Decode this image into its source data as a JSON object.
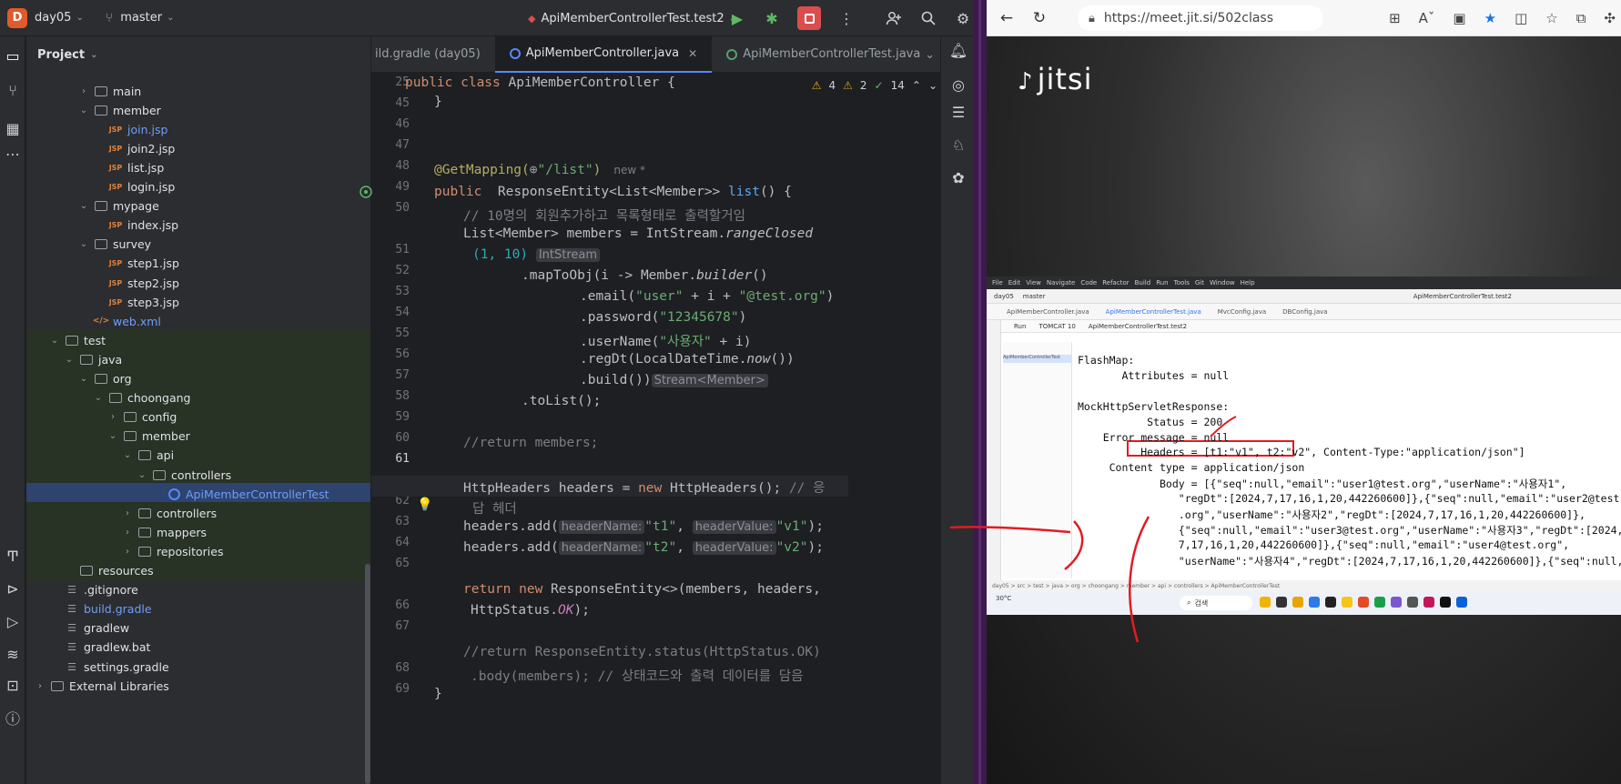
{
  "ide": {
    "project_badge": "D",
    "project_name": "day05",
    "branch": "master",
    "run_config": "ApiMemberControllerTest.test2",
    "project_panel_title": "Project",
    "tabs": [
      {
        "label": "ild.gradle (day05)"
      },
      {
        "label": "ApiMemberController.java"
      },
      {
        "label": "ApiMemberControllerTest.java"
      }
    ],
    "inspections": {
      "warnings": "4",
      "weak": "2",
      "ok": "14"
    },
    "tree": [
      {
        "label": "main",
        "depth": 3,
        "type": "folder",
        "chev": "›"
      },
      {
        "label": "member",
        "depth": 3,
        "type": "folder",
        "chev": "⌄"
      },
      {
        "label": "join.jsp",
        "depth": 4,
        "type": "jsp",
        "cls": "file-blue"
      },
      {
        "label": "join2.jsp",
        "depth": 4,
        "type": "jsp"
      },
      {
        "label": "list.jsp",
        "depth": 4,
        "type": "jsp"
      },
      {
        "label": "login.jsp",
        "depth": 4,
        "type": "jsp"
      },
      {
        "label": "mypage",
        "depth": 3,
        "type": "folder",
        "chev": "⌄"
      },
      {
        "label": "index.jsp",
        "depth": 4,
        "type": "jsp"
      },
      {
        "label": "survey",
        "depth": 3,
        "type": "folder",
        "chev": "⌄"
      },
      {
        "label": "step1.jsp",
        "depth": 4,
        "type": "jsp"
      },
      {
        "label": "step2.jsp",
        "depth": 4,
        "type": "jsp"
      },
      {
        "label": "step3.jsp",
        "depth": 4,
        "type": "jsp"
      },
      {
        "label": "web.xml",
        "depth": 3,
        "type": "xml",
        "cls": "file-blue"
      },
      {
        "label": "test",
        "depth": 1,
        "type": "folder",
        "chev": "⌄",
        "test": true
      },
      {
        "label": "java",
        "depth": 2,
        "type": "folder",
        "chev": "⌄",
        "test": true
      },
      {
        "label": "org",
        "depth": 3,
        "type": "folder",
        "chev": "⌄",
        "test": true
      },
      {
        "label": "choongang",
        "depth": 4,
        "type": "folder",
        "chev": "⌄",
        "test": true
      },
      {
        "label": "config",
        "depth": 5,
        "type": "folder",
        "chev": "›",
        "test": true
      },
      {
        "label": "member",
        "depth": 5,
        "type": "folder",
        "chev": "⌄",
        "test": true
      },
      {
        "label": "api",
        "depth": 6,
        "type": "folder",
        "chev": "⌄",
        "test": true
      },
      {
        "label": "controllers",
        "depth": 7,
        "type": "folder",
        "chev": "⌄",
        "test": true
      },
      {
        "label": "ApiMemberControllerTest",
        "depth": 8,
        "type": "class",
        "test": true,
        "selected": true,
        "cls": "file-blue"
      },
      {
        "label": "controllers",
        "depth": 6,
        "type": "folder",
        "chev": "›",
        "test": true
      },
      {
        "label": "mappers",
        "depth": 6,
        "type": "folder",
        "chev": "›",
        "test": true
      },
      {
        "label": "repositories",
        "depth": 6,
        "type": "folder",
        "chev": "›",
        "test": true
      },
      {
        "label": "resources",
        "depth": 2,
        "type": "folder",
        "test": true
      },
      {
        "label": ".gitignore",
        "depth": 1,
        "type": "file"
      },
      {
        "label": "build.gradle",
        "depth": 1,
        "type": "file",
        "cls": "file-blue"
      },
      {
        "label": "gradlew",
        "depth": 1,
        "type": "file"
      },
      {
        "label": "gradlew.bat",
        "depth": 1,
        "type": "file"
      },
      {
        "label": "settings.gradle",
        "depth": 1,
        "type": "file"
      },
      {
        "label": "External Libraries",
        "depth": 0,
        "type": "folder",
        "chev": "›"
      }
    ],
    "sticky_line": {
      "num": "25",
      "text": "public class ApiMemberController {"
    },
    "line_numbers": [
      "45",
      "46",
      "47",
      "48",
      "49",
      "50",
      "",
      "51",
      "52",
      "53",
      "54",
      "55",
      "56",
      "57",
      "58",
      "59",
      "60",
      "61",
      "",
      "62",
      "63",
      "64",
      "65",
      "",
      "66",
      "67",
      "",
      "68",
      "69"
    ],
    "code": {
      "l45": "}",
      "l47_ann": "@GetMapping(",
      "l47_str": "\"/list\"",
      "l47_close": ")",
      "l47_hint": "new *",
      "l48_kw": "public",
      "l48_type": "ResponseEntity<List<Member>>",
      "l48_fn": "list",
      "l48_rest": "() {",
      "l49": "// 10명의 회원추가하고 목록형태로 출력할거임",
      "l50_a": "List<Member> members = IntStream.",
      "l50_b": "rangeClosed",
      "l50c_a": "(1, 10)",
      "l50c_hint": "IntStream",
      "l51": ".mapToObj(i -> Member.",
      "l51_b": "builder",
      "l51_c": "()",
      "l52_a": ".email(",
      "l52_s1": "\"user\"",
      "l52_m": " + i + ",
      "l52_s2": "\"@test.org\"",
      "l52_c": ")",
      "l53_a": ".password(",
      "l53_s": "\"12345678\"",
      "l53_c": ")",
      "l54_a": ".userName(",
      "l54_s": "\"사용자\"",
      "l54_c": " + i)",
      "l55_a": ".regDt(LocalDateTime.",
      "l55_b": "now",
      "l55_c": "())",
      "l56_a": ".build())",
      "l56_hint": "Stream<Member>",
      "l57": ".toList();",
      "l59": "//return members;",
      "l61_a": "HttpHeaders headers = ",
      "l61_kw": "new",
      "l61_b": " HttpHeaders(); ",
      "l61_c": "// 응",
      "l61w": "답 헤더",
      "l62_a": "headers.add(",
      "l62_h1": "headerName:",
      "l62_s1": "\"t1\"",
      "l62_comma": ", ",
      "l62_h2": "headerValue:",
      "l62_s2": "\"v1\"",
      "l62_c": ");",
      "l63_s1": "\"t2\"",
      "l63_s2": "\"v2\"",
      "l65_kw": "return new",
      "l65_b": " ResponseEntity<>(members, headers,",
      "l65w_a": "HttpStatus.",
      "l65w_b": "OK",
      "l65w_c": ");",
      "l67": "//return ResponseEntity.status(HttpStatus.OK)",
      "l67w": ".body(members); // 상태코드와 출력 데이터를 담음",
      "l68": "}"
    }
  },
  "browser": {
    "url": "https://meet.jit.si/502class",
    "meet_logo": "jitsi",
    "shared_screen": {
      "menu": [
        "File",
        "Edit",
        "View",
        "Navigate",
        "Code",
        "Refactor",
        "Build",
        "Run",
        "Tools",
        "Git",
        "Window",
        "Help"
      ],
      "project": "day05",
      "branch": "master",
      "run_config": "ApiMemberControllerTest.test2",
      "tabs": [
        "ApiMemberController.java",
        "ApiMemberControllerTest.java",
        "MvcConfig.java",
        "DBConfig.java"
      ],
      "run_tabs": [
        "Run",
        "TOMCAT 10",
        "ApiMemberControllerTest.test2"
      ],
      "tree_item": "ApiMemberControllerTest",
      "console": [
        "FlashMap:",
        "       Attributes = null",
        "",
        "MockHttpServletResponse:",
        "           Status = 200",
        "    Error message = null",
        "          Headers = [t1:\"v1\", t2:\"v2\", Content-Type:\"application/json\"]",
        "     Content type = application/json",
        "             Body = [{\"seq\":null,\"email\":\"user1@test.org\",\"userName\":\"사용자1\",",
        "                \"regDt\":[2024,7,17,16,1,20,442260600]},{\"seq\":null,\"email\":\"user2@test",
        "                .org\",\"userName\":\"사용자2\",\"regDt\":[2024,7,17,16,1,20,442260600]},",
        "                {\"seq\":null,\"email\":\"user3@test.org\",\"userName\":\"사용자3\",\"regDt\":[2024,",
        "                7,17,16,1,20,442260600]},{\"seq\":null,\"email\":\"user4@test.org\",",
        "                \"userName\":\"사용자4\",\"regDt\":[2024,7,17,16,1,20,442260600]},{\"seq\":null,"
      ],
      "status_path": "day05 > src > test > java > org > choongang > member > api > controllers > ApiMemberControllerTest",
      "taskbar_search": "검색",
      "weather": "30°C"
    }
  },
  "colors": {
    "accent": "#548af7",
    "stop": "#db4d4d",
    "annotation_red": "#e31b23"
  }
}
